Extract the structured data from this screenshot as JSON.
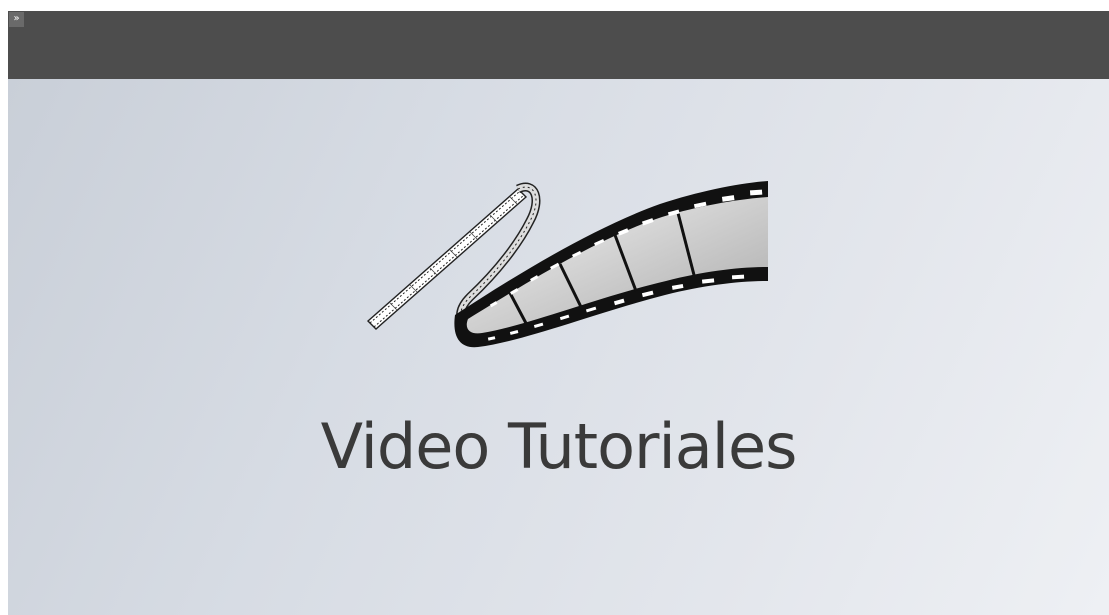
{
  "toolbar": {
    "expand_label": "»",
    "expand_icon": "double-chevron-right-icon",
    "bar_color": "#4d4d4d"
  },
  "slide": {
    "title": "Video Tutoriales",
    "image_icon": "film-strip-icon",
    "title_color": "#3a3a3a",
    "background_from": "#c9cfd8",
    "background_to": "#eef0f4"
  }
}
